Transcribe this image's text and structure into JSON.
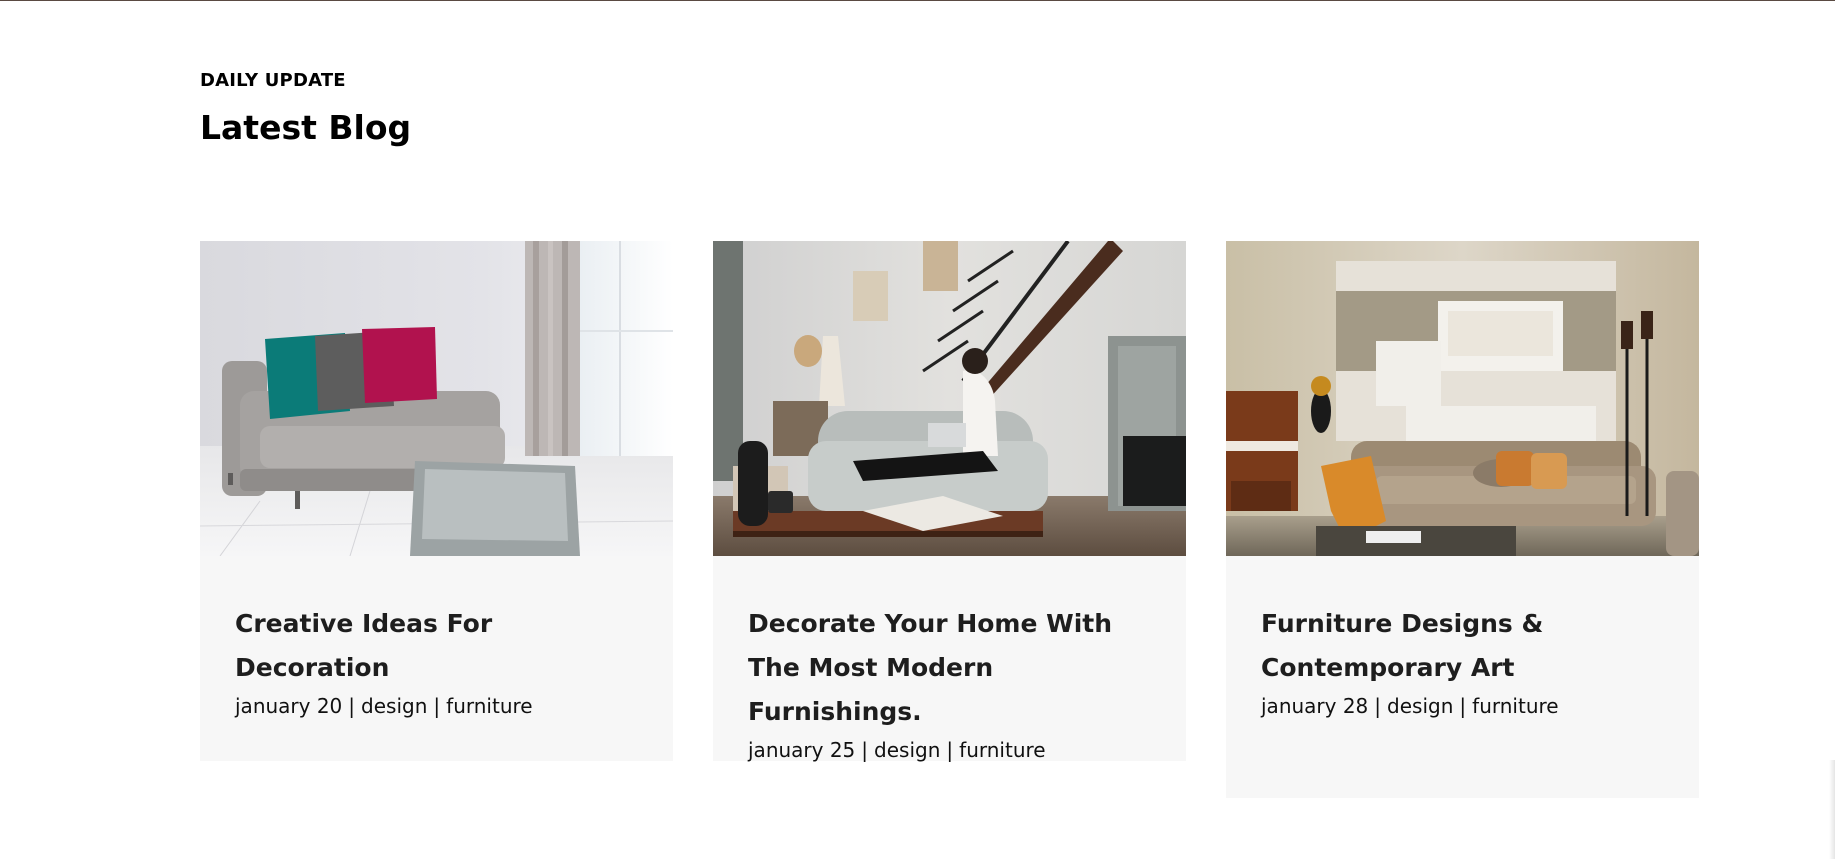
{
  "section": {
    "eyebrow": "DAILY UPDATE",
    "title": "Latest Blog"
  },
  "posts": [
    {
      "title": "Creative Ideas For Decoration",
      "date": "january 20",
      "categories": [
        "design",
        "furniture"
      ],
      "separator": "|",
      "image_subject": "grey sofa with teal, grey and magenta pillows in a bright white room"
    },
    {
      "title": "Decorate Your Home With The Most Modern Furnishings.",
      "date": "january 25",
      "categories": [
        "design",
        "furniture"
      ],
      "separator": "|",
      "image_subject": "woman with laptop on grey sofa beside a wooden staircase"
    },
    {
      "title": "Furniture Designs & Contemporary Art",
      "date": "january 28",
      "categories": [
        "design",
        "furniture"
      ],
      "separator": "|",
      "image_subject": "beige living room with piano, lamps and orange cushions"
    }
  ],
  "colors": {
    "card_background": "#f7f7f7",
    "title_text": "#1e1e1e",
    "top_rule": "#5a4a42"
  }
}
